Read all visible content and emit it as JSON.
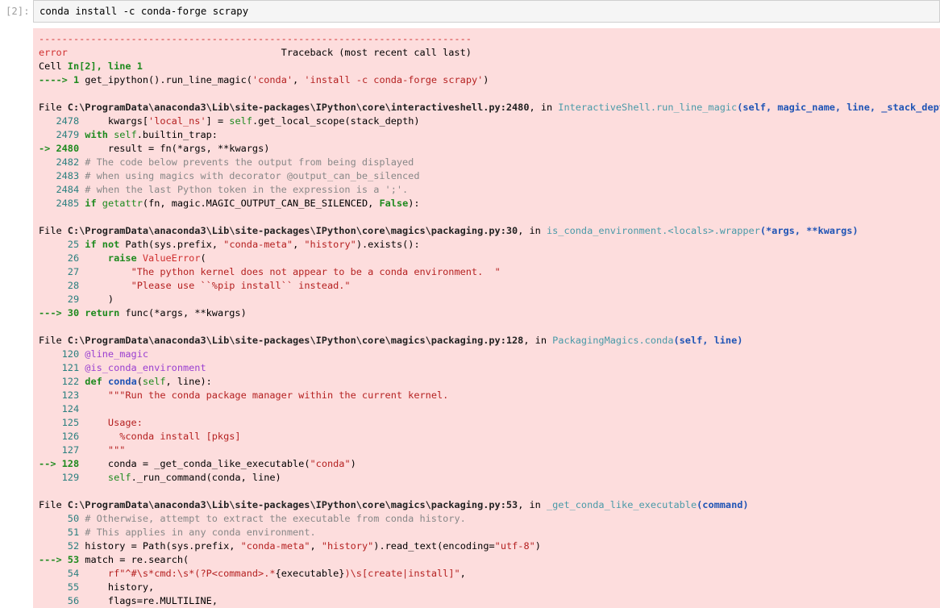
{
  "input_cell": {
    "prompt": "[2]:",
    "code": "conda install -c conda-forge scrapy"
  },
  "traceback": {
    "lines": [
      [
        {
          "t": "---------------------------------------------------------------------------",
          "c": "r"
        }
      ],
      [
        {
          "t": "error",
          "c": "r"
        },
        {
          "t": "                                     Traceback (most recent call last)",
          "c": "dk"
        }
      ],
      [
        {
          "t": "Cell ",
          "c": "dk"
        },
        {
          "t": "In[2], line 1",
          "c": "gb"
        }
      ],
      [
        {
          "t": "----> 1 ",
          "c": "arw"
        },
        {
          "t": "get_ipython()",
          "c": "dk"
        },
        {
          "t": ".",
          "c": "dk"
        },
        {
          "t": "run_line_magic(",
          "c": "dk"
        },
        {
          "t": "'conda'",
          "c": "str"
        },
        {
          "t": ", ",
          "c": "dk"
        },
        {
          "t": "'install -c conda-forge scrapy'",
          "c": "str"
        },
        {
          "t": ")",
          "c": "dk"
        }
      ],
      [
        {
          "t": "",
          "c": "dk"
        }
      ],
      [
        {
          "t": "File ",
          "c": "dk"
        },
        {
          "t": "C:\\ProgramData\\anaconda3\\Lib\\site-packages\\IPython\\core\\interactiveshell.py:2480",
          "c": "b"
        },
        {
          "t": ", in ",
          "c": "dk"
        },
        {
          "t": "InteractiveShell.run_line_magic",
          "c": "c"
        },
        {
          "t": "(self, magic_name, line, _stack_depth)",
          "c": "bl"
        }
      ],
      [
        {
          "t": "   2478 ",
          "c": "nm"
        },
        {
          "t": "    kwargs[",
          "c": "dk"
        },
        {
          "t": "'local_ns'",
          "c": "str"
        },
        {
          "t": "] ",
          "c": "dk"
        },
        {
          "t": "=",
          "c": "dk"
        },
        {
          "t": " ",
          "c": "dk"
        },
        {
          "t": "self",
          "c": "g"
        },
        {
          "t": ".",
          "c": "dk"
        },
        {
          "t": "get_local_scope(stack_depth)",
          "c": "dk"
        }
      ],
      [
        {
          "t": "   2479 ",
          "c": "nm"
        },
        {
          "t": "with",
          "c": "gb"
        },
        {
          "t": " ",
          "c": "dk"
        },
        {
          "t": "self",
          "c": "g"
        },
        {
          "t": ".",
          "c": "dk"
        },
        {
          "t": "builtin_trap:",
          "c": "dk"
        }
      ],
      [
        {
          "t": "-> 2480 ",
          "c": "arw"
        },
        {
          "t": "    result ",
          "c": "dk"
        },
        {
          "t": "=",
          "c": "dk"
        },
        {
          "t": " fn(",
          "c": "dk"
        },
        {
          "t": "*",
          "c": "dk"
        },
        {
          "t": "args, ",
          "c": "dk"
        },
        {
          "t": "**",
          "c": "dk"
        },
        {
          "t": "kwargs)",
          "c": "dk"
        }
      ],
      [
        {
          "t": "   2482 ",
          "c": "nm"
        },
        {
          "t": "# The code below prevents the output from being displayed",
          "c": "cm"
        }
      ],
      [
        {
          "t": "   2483 ",
          "c": "nm"
        },
        {
          "t": "# when using magics with decorator @output_can_be_silenced",
          "c": "cm"
        }
      ],
      [
        {
          "t": "   2484 ",
          "c": "nm"
        },
        {
          "t": "# when the last Python token in the expression is a ';'.",
          "c": "cm"
        }
      ],
      [
        {
          "t": "   2485 ",
          "c": "nm"
        },
        {
          "t": "if",
          "c": "gb"
        },
        {
          "t": " ",
          "c": "dk"
        },
        {
          "t": "getattr",
          "c": "g"
        },
        {
          "t": "(fn, magic",
          "c": "dk"
        },
        {
          "t": ".",
          "c": "dk"
        },
        {
          "t": "MAGIC_OUTPUT_CAN_BE_SILENCED, ",
          "c": "dk"
        },
        {
          "t": "False",
          "c": "gb"
        },
        {
          "t": "):",
          "c": "dk"
        }
      ],
      [
        {
          "t": "",
          "c": "dk"
        }
      ],
      [
        {
          "t": "File ",
          "c": "dk"
        },
        {
          "t": "C:\\ProgramData\\anaconda3\\Lib\\site-packages\\IPython\\core\\magics\\packaging.py:30",
          "c": "b"
        },
        {
          "t": ", in ",
          "c": "dk"
        },
        {
          "t": "is_conda_environment.<locals>.wrapper",
          "c": "c"
        },
        {
          "t": "(*args, **kwargs)",
          "c": "bl"
        }
      ],
      [
        {
          "t": "     25 ",
          "c": "nm"
        },
        {
          "t": "if",
          "c": "gb"
        },
        {
          "t": " ",
          "c": "dk"
        },
        {
          "t": "not",
          "c": "gb"
        },
        {
          "t": " Path(sys",
          "c": "dk"
        },
        {
          "t": ".",
          "c": "dk"
        },
        {
          "t": "prefix, ",
          "c": "dk"
        },
        {
          "t": "\"conda-meta\"",
          "c": "str"
        },
        {
          "t": ", ",
          "c": "dk"
        },
        {
          "t": "\"history\"",
          "c": "str"
        },
        {
          "t": ")",
          "c": "dk"
        },
        {
          "t": ".",
          "c": "dk"
        },
        {
          "t": "exists():",
          "c": "dk"
        }
      ],
      [
        {
          "t": "     26 ",
          "c": "nm"
        },
        {
          "t": "    ",
          "c": "dk"
        },
        {
          "t": "raise",
          "c": "gb"
        },
        {
          "t": " ",
          "c": "dk"
        },
        {
          "t": "ValueError",
          "c": "r"
        },
        {
          "t": "(",
          "c": "dk"
        }
      ],
      [
        {
          "t": "     27 ",
          "c": "nm"
        },
        {
          "t": "        ",
          "c": "dk"
        },
        {
          "t": "\"The python kernel does not appear to be a conda environment.  \"",
          "c": "str"
        }
      ],
      [
        {
          "t": "     28 ",
          "c": "nm"
        },
        {
          "t": "        ",
          "c": "dk"
        },
        {
          "t": "\"Please use ``%pip install`` instead.\"",
          "c": "str"
        }
      ],
      [
        {
          "t": "     29 ",
          "c": "nm"
        },
        {
          "t": "    )",
          "c": "dk"
        }
      ],
      [
        {
          "t": "---> 30 ",
          "c": "arw"
        },
        {
          "t": "return",
          "c": "gb"
        },
        {
          "t": " func(",
          "c": "dk"
        },
        {
          "t": "*",
          "c": "dk"
        },
        {
          "t": "args, ",
          "c": "dk"
        },
        {
          "t": "**",
          "c": "dk"
        },
        {
          "t": "kwargs)",
          "c": "dk"
        }
      ],
      [
        {
          "t": "",
          "c": "dk"
        }
      ],
      [
        {
          "t": "File ",
          "c": "dk"
        },
        {
          "t": "C:\\ProgramData\\anaconda3\\Lib\\site-packages\\IPython\\core\\magics\\packaging.py:128",
          "c": "b"
        },
        {
          "t": ", in ",
          "c": "dk"
        },
        {
          "t": "PackagingMagics.conda",
          "c": "c"
        },
        {
          "t": "(self, line)",
          "c": "bl"
        }
      ],
      [
        {
          "t": "    120 ",
          "c": "nm"
        },
        {
          "t": "@line_magic",
          "c": "pu"
        }
      ],
      [
        {
          "t": "    121 ",
          "c": "nm"
        },
        {
          "t": "@is_conda_environment",
          "c": "pu"
        }
      ],
      [
        {
          "t": "    122 ",
          "c": "nm"
        },
        {
          "t": "def",
          "c": "gb"
        },
        {
          "t": " ",
          "c": "dk"
        },
        {
          "t": "conda",
          "c": "bl"
        },
        {
          "t": "(",
          "c": "dk"
        },
        {
          "t": "self",
          "c": "g"
        },
        {
          "t": ", line):",
          "c": "dk"
        }
      ],
      [
        {
          "t": "    123 ",
          "c": "nm"
        },
        {
          "t": "    ",
          "c": "dk"
        },
        {
          "t": "\"\"\"Run the conda package manager within the current kernel.",
          "c": "str"
        }
      ],
      [
        {
          "t": "    124 ",
          "c": "nm"
        }
      ],
      [
        {
          "t": "    125 ",
          "c": "nm"
        },
        {
          "t": "    Usage:",
          "c": "str"
        }
      ],
      [
        {
          "t": "    126 ",
          "c": "nm"
        },
        {
          "t": "      %conda install [pkgs]",
          "c": "str"
        }
      ],
      [
        {
          "t": "    127 ",
          "c": "nm"
        },
        {
          "t": "    \"\"\"",
          "c": "str"
        }
      ],
      [
        {
          "t": "--> 128 ",
          "c": "arw"
        },
        {
          "t": "    conda ",
          "c": "dk"
        },
        {
          "t": "=",
          "c": "dk"
        },
        {
          "t": " _get_conda_like_executable(",
          "c": "dk"
        },
        {
          "t": "\"conda\"",
          "c": "str"
        },
        {
          "t": ")",
          "c": "dk"
        }
      ],
      [
        {
          "t": "    129 ",
          "c": "nm"
        },
        {
          "t": "    ",
          "c": "dk"
        },
        {
          "t": "self",
          "c": "g"
        },
        {
          "t": ".",
          "c": "dk"
        },
        {
          "t": "_run_command(conda, line)",
          "c": "dk"
        }
      ],
      [
        {
          "t": "",
          "c": "dk"
        }
      ],
      [
        {
          "t": "File ",
          "c": "dk"
        },
        {
          "t": "C:\\ProgramData\\anaconda3\\Lib\\site-packages\\IPython\\core\\magics\\packaging.py:53",
          "c": "b"
        },
        {
          "t": ", in ",
          "c": "dk"
        },
        {
          "t": "_get_conda_like_executable",
          "c": "c"
        },
        {
          "t": "(command)",
          "c": "bl"
        }
      ],
      [
        {
          "t": "     50 ",
          "c": "nm"
        },
        {
          "t": "# Otherwise, attempt to extract the executable from conda history.",
          "c": "cm"
        }
      ],
      [
        {
          "t": "     51 ",
          "c": "nm"
        },
        {
          "t": "# This applies in any conda environment.",
          "c": "cm"
        }
      ],
      [
        {
          "t": "     52 ",
          "c": "nm"
        },
        {
          "t": "history ",
          "c": "dk"
        },
        {
          "t": "=",
          "c": "dk"
        },
        {
          "t": " Path(sys",
          "c": "dk"
        },
        {
          "t": ".",
          "c": "dk"
        },
        {
          "t": "prefix, ",
          "c": "dk"
        },
        {
          "t": "\"conda-meta\"",
          "c": "str"
        },
        {
          "t": ", ",
          "c": "dk"
        },
        {
          "t": "\"history\"",
          "c": "str"
        },
        {
          "t": ")",
          "c": "dk"
        },
        {
          "t": ".",
          "c": "dk"
        },
        {
          "t": "read_text(encoding",
          "c": "dk"
        },
        {
          "t": "=",
          "c": "dk"
        },
        {
          "t": "\"utf-8\"",
          "c": "str"
        },
        {
          "t": ")",
          "c": "dk"
        }
      ],
      [
        {
          "t": "---> 53 ",
          "c": "arw"
        },
        {
          "t": "match ",
          "c": "dk"
        },
        {
          "t": "=",
          "c": "dk"
        },
        {
          "t": " re",
          "c": "dk"
        },
        {
          "t": ".",
          "c": "dk"
        },
        {
          "t": "search(",
          "c": "dk"
        }
      ],
      [
        {
          "t": "     54 ",
          "c": "nm"
        },
        {
          "t": "    ",
          "c": "dk"
        },
        {
          "t": "rf\"^#\\s*cmd:\\s*(?P<command>.*",
          "c": "str"
        },
        {
          "t": "{",
          "c": "dk"
        },
        {
          "t": "executable",
          "c": "dk"
        },
        {
          "t": "}",
          "c": "dk"
        },
        {
          "t": ")\\s[create|install]\"",
          "c": "str"
        },
        {
          "t": ",",
          "c": "dk"
        }
      ],
      [
        {
          "t": "     55 ",
          "c": "nm"
        },
        {
          "t": "    history,",
          "c": "dk"
        }
      ],
      [
        {
          "t": "     56 ",
          "c": "nm"
        },
        {
          "t": "    flags",
          "c": "dk"
        },
        {
          "t": "=",
          "c": "dk"
        },
        {
          "t": "re",
          "c": "dk"
        },
        {
          "t": ".",
          "c": "dk"
        },
        {
          "t": "MULTILINE,",
          "c": "dk"
        }
      ]
    ]
  }
}
